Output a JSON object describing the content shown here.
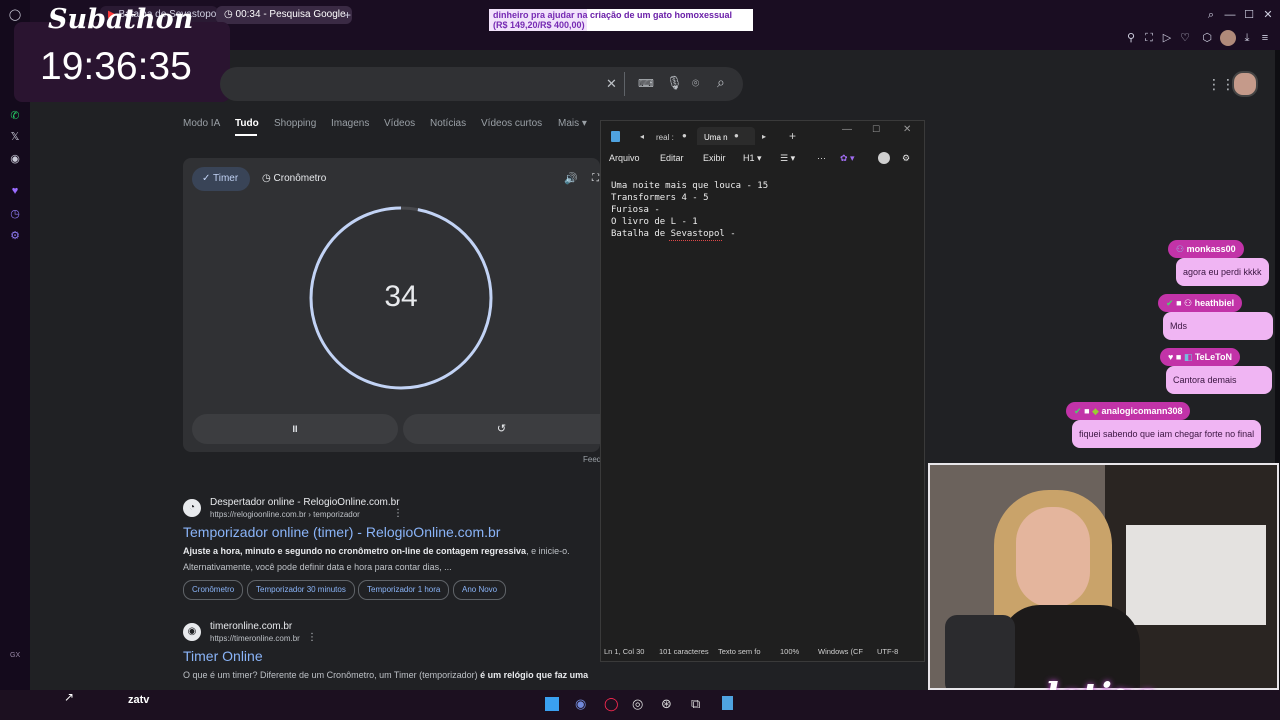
{
  "browser": {
    "tabs": [
      {
        "label": "Batalha de Sevastopol (Bitv"
      },
      {
        "label": "00:34 - Pesquisa Google"
      }
    ],
    "new_tab": "+"
  },
  "overlay": {
    "subathon_title": "Subathon",
    "subathon_clock": "19:36:35",
    "donation_line1": "dinheiro pra ajudar na criação de um gato homoxessual",
    "donation_line2": "(R$ 149,20/R$ 400,00)",
    "donation_progress": 0.373,
    "brand": "letiza"
  },
  "google": {
    "tabs": [
      "Modo IA",
      "Tudo",
      "Shopping",
      "Imagens",
      "Vídeos",
      "Notícias",
      "Vídeos curtos",
      "Mais"
    ],
    "timer_tab": "Timer",
    "stopwatch_tab": "Cronômetro",
    "timer_value": "34",
    "timer_progress": 0.97,
    "pause_icon": "II",
    "reset_icon": "↺",
    "feedback": "Feed",
    "results": [
      {
        "site": "Despertador online - RelogioOnline.com.br",
        "url": "https://relogioonline.com.br › temporizador",
        "title": "Temporizador online (timer) - RelogioOnline.com.br",
        "snippet_bold": "Ajuste a hora, minuto e segundo no cronômetro on-line de contagem regressiva",
        "snippet_rest": ", e inicie-o.",
        "snippet_line2": "Alternativamente, você pode definir data e hora para contar dias, ...",
        "chips": [
          "Cronômetro",
          "Temporizador 30 minutos",
          "Temporizador 1 hora",
          "Ano Novo"
        ]
      },
      {
        "site": "timeronline.com.br",
        "url": "https://timeronline.com.br",
        "title": "Timer Online",
        "snippet": "O que é um timer? Diferente de um Cronômetro, um Timer (temporizador)",
        "snippet_bold": " é um relógio que faz uma"
      }
    ]
  },
  "notepad": {
    "tabs": [
      "real :",
      "Uma n"
    ],
    "menu": [
      "Arquivo",
      "Editar",
      "Exibir",
      "H1"
    ],
    "lines": [
      "Uma noite mais que louca - 15",
      "Transformers 4 - 5",
      "Furiosa -",
      "O livro de L - 1",
      "Batalha de Sevastopol -"
    ],
    "status": [
      "Ln 1, Col 30",
      "101 caracteres",
      "Texto sem fo",
      "100%",
      "Windows (CF",
      "UTF-8"
    ]
  },
  "chat": [
    {
      "user": "monkass00",
      "message": "agora eu perdi kkkk"
    },
    {
      "user": "heathbiel",
      "message": "Mds"
    },
    {
      "user": "TeLeToN",
      "message": "Cantora demais"
    },
    {
      "user": "analogicomann308",
      "message": "fiquei sabendo que iam chegar forte no final"
    }
  ],
  "sidebar": {
    "gx_label": "GX"
  },
  "taskbar": {
    "app_label": "zatv"
  },
  "colors": {
    "chat_name_bg": "#c233a8",
    "chat_msg_bg": "#f0b5f3",
    "google_link": "#8ab4f8",
    "timer_ring": "#c2d3f5"
  }
}
